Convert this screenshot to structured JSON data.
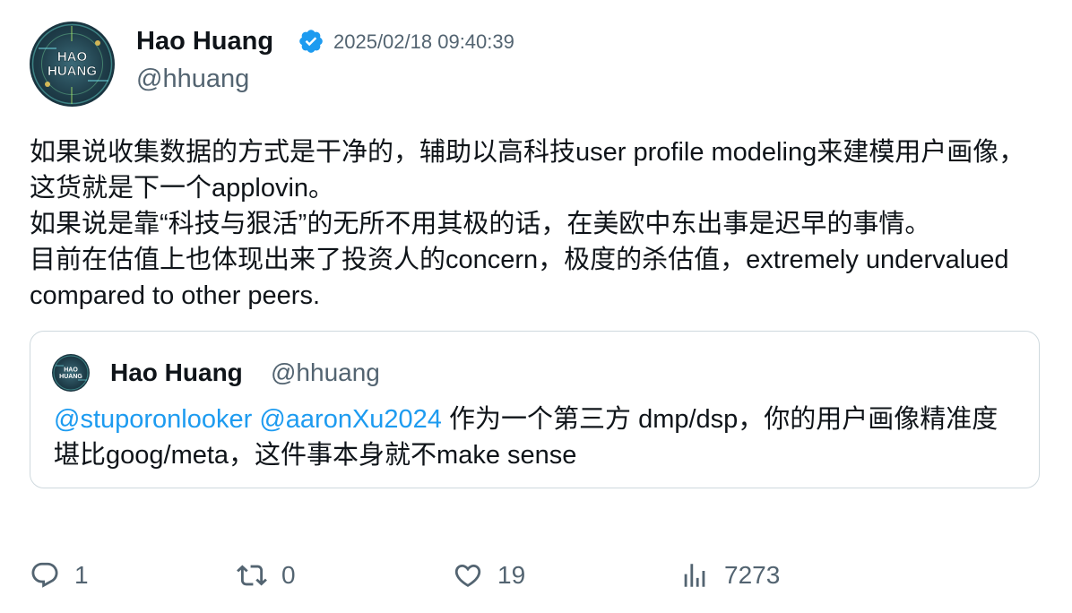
{
  "tweet": {
    "author_name": "Hao Huang",
    "handle": "@hhuang",
    "timestamp": "2025/02/18 09:40:39",
    "avatar_text_line1": "HAO",
    "avatar_text_line2": "HUANG",
    "body_lines": [
      "如果说收集数据的方式是干净的，辅助以高科技user profile modeling来建模用户画像，这货就是下一个applovin。",
      "如果说是靠“科技与狠活”的无所不用其极的话，在美欧中东出事是迟早的事情。",
      "目前在估值上也体现出来了投资人的concern，极度的杀估值，extremely undervalued compared to other peers."
    ]
  },
  "quote": {
    "author_name": "Hao Huang",
    "handle": "@hhuang",
    "mention1": "@stuporonlooker",
    "mention2": "@aaronXu2024",
    "text": " 作为一个第三方 dmp/dsp，你的用户画像精准度堪比goog/meta，这件事本身就不make sense"
  },
  "actions": {
    "replies": "1",
    "retweets": "0",
    "likes": "19",
    "views": "7273"
  },
  "colors": {
    "text_primary": "#0f1419",
    "text_secondary": "#536471",
    "link": "#1d9bf0",
    "verified": "#1d9bf0",
    "border": "#cfd9de"
  },
  "icons": {
    "verified": "verified-badge-icon",
    "reply": "reply-icon",
    "retweet": "retweet-icon",
    "like": "heart-icon",
    "views": "views-chart-icon"
  }
}
